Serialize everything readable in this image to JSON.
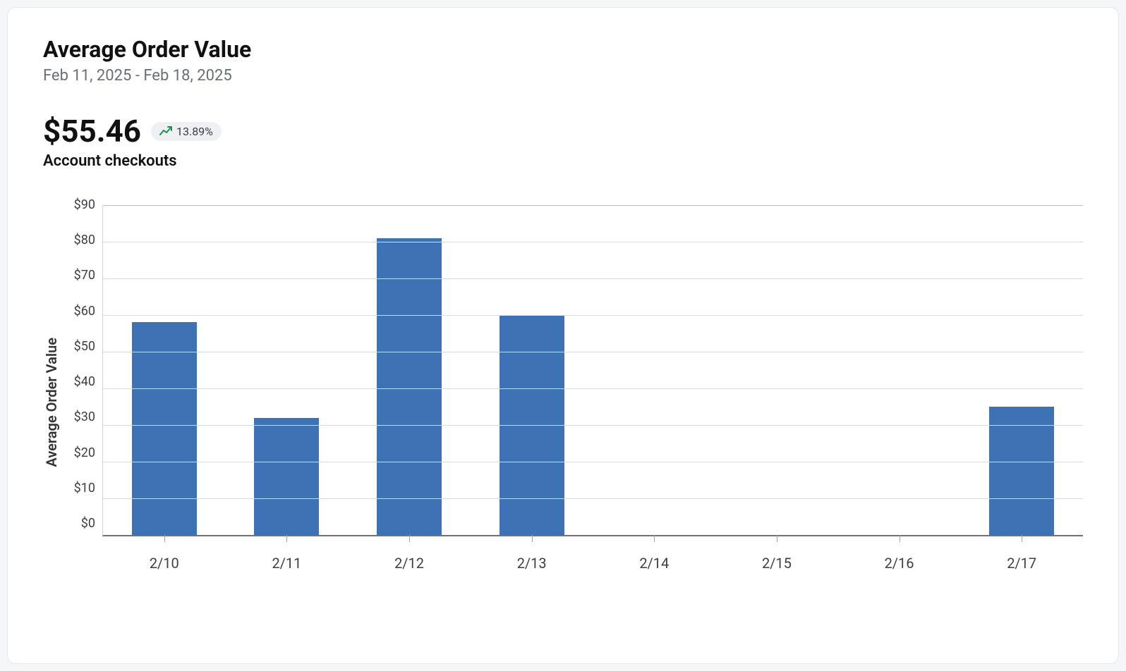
{
  "header": {
    "title": "Average Order Value",
    "date_range": "Feb 11, 2025 - Feb 18, 2025"
  },
  "metric": {
    "value": "$55.46",
    "delta": "13.89%",
    "delta_direction": "up",
    "sub_label": "Account checkouts"
  },
  "chart_data": {
    "type": "bar",
    "categories": [
      "2/10",
      "2/11",
      "2/12",
      "2/13",
      "2/14",
      "2/15",
      "2/16",
      "2/17"
    ],
    "values": [
      58,
      32,
      81,
      60,
      0,
      0,
      0,
      35
    ],
    "title": "Average Order Value",
    "xlabel": "",
    "ylabel": "Average Order Value",
    "ylim": [
      0,
      90
    ],
    "y_ticks": [
      "$90",
      "$80",
      "$70",
      "$60",
      "$50",
      "$40",
      "$30",
      "$20",
      "$10",
      "$0"
    ],
    "bar_color": "#3d72b4"
  }
}
